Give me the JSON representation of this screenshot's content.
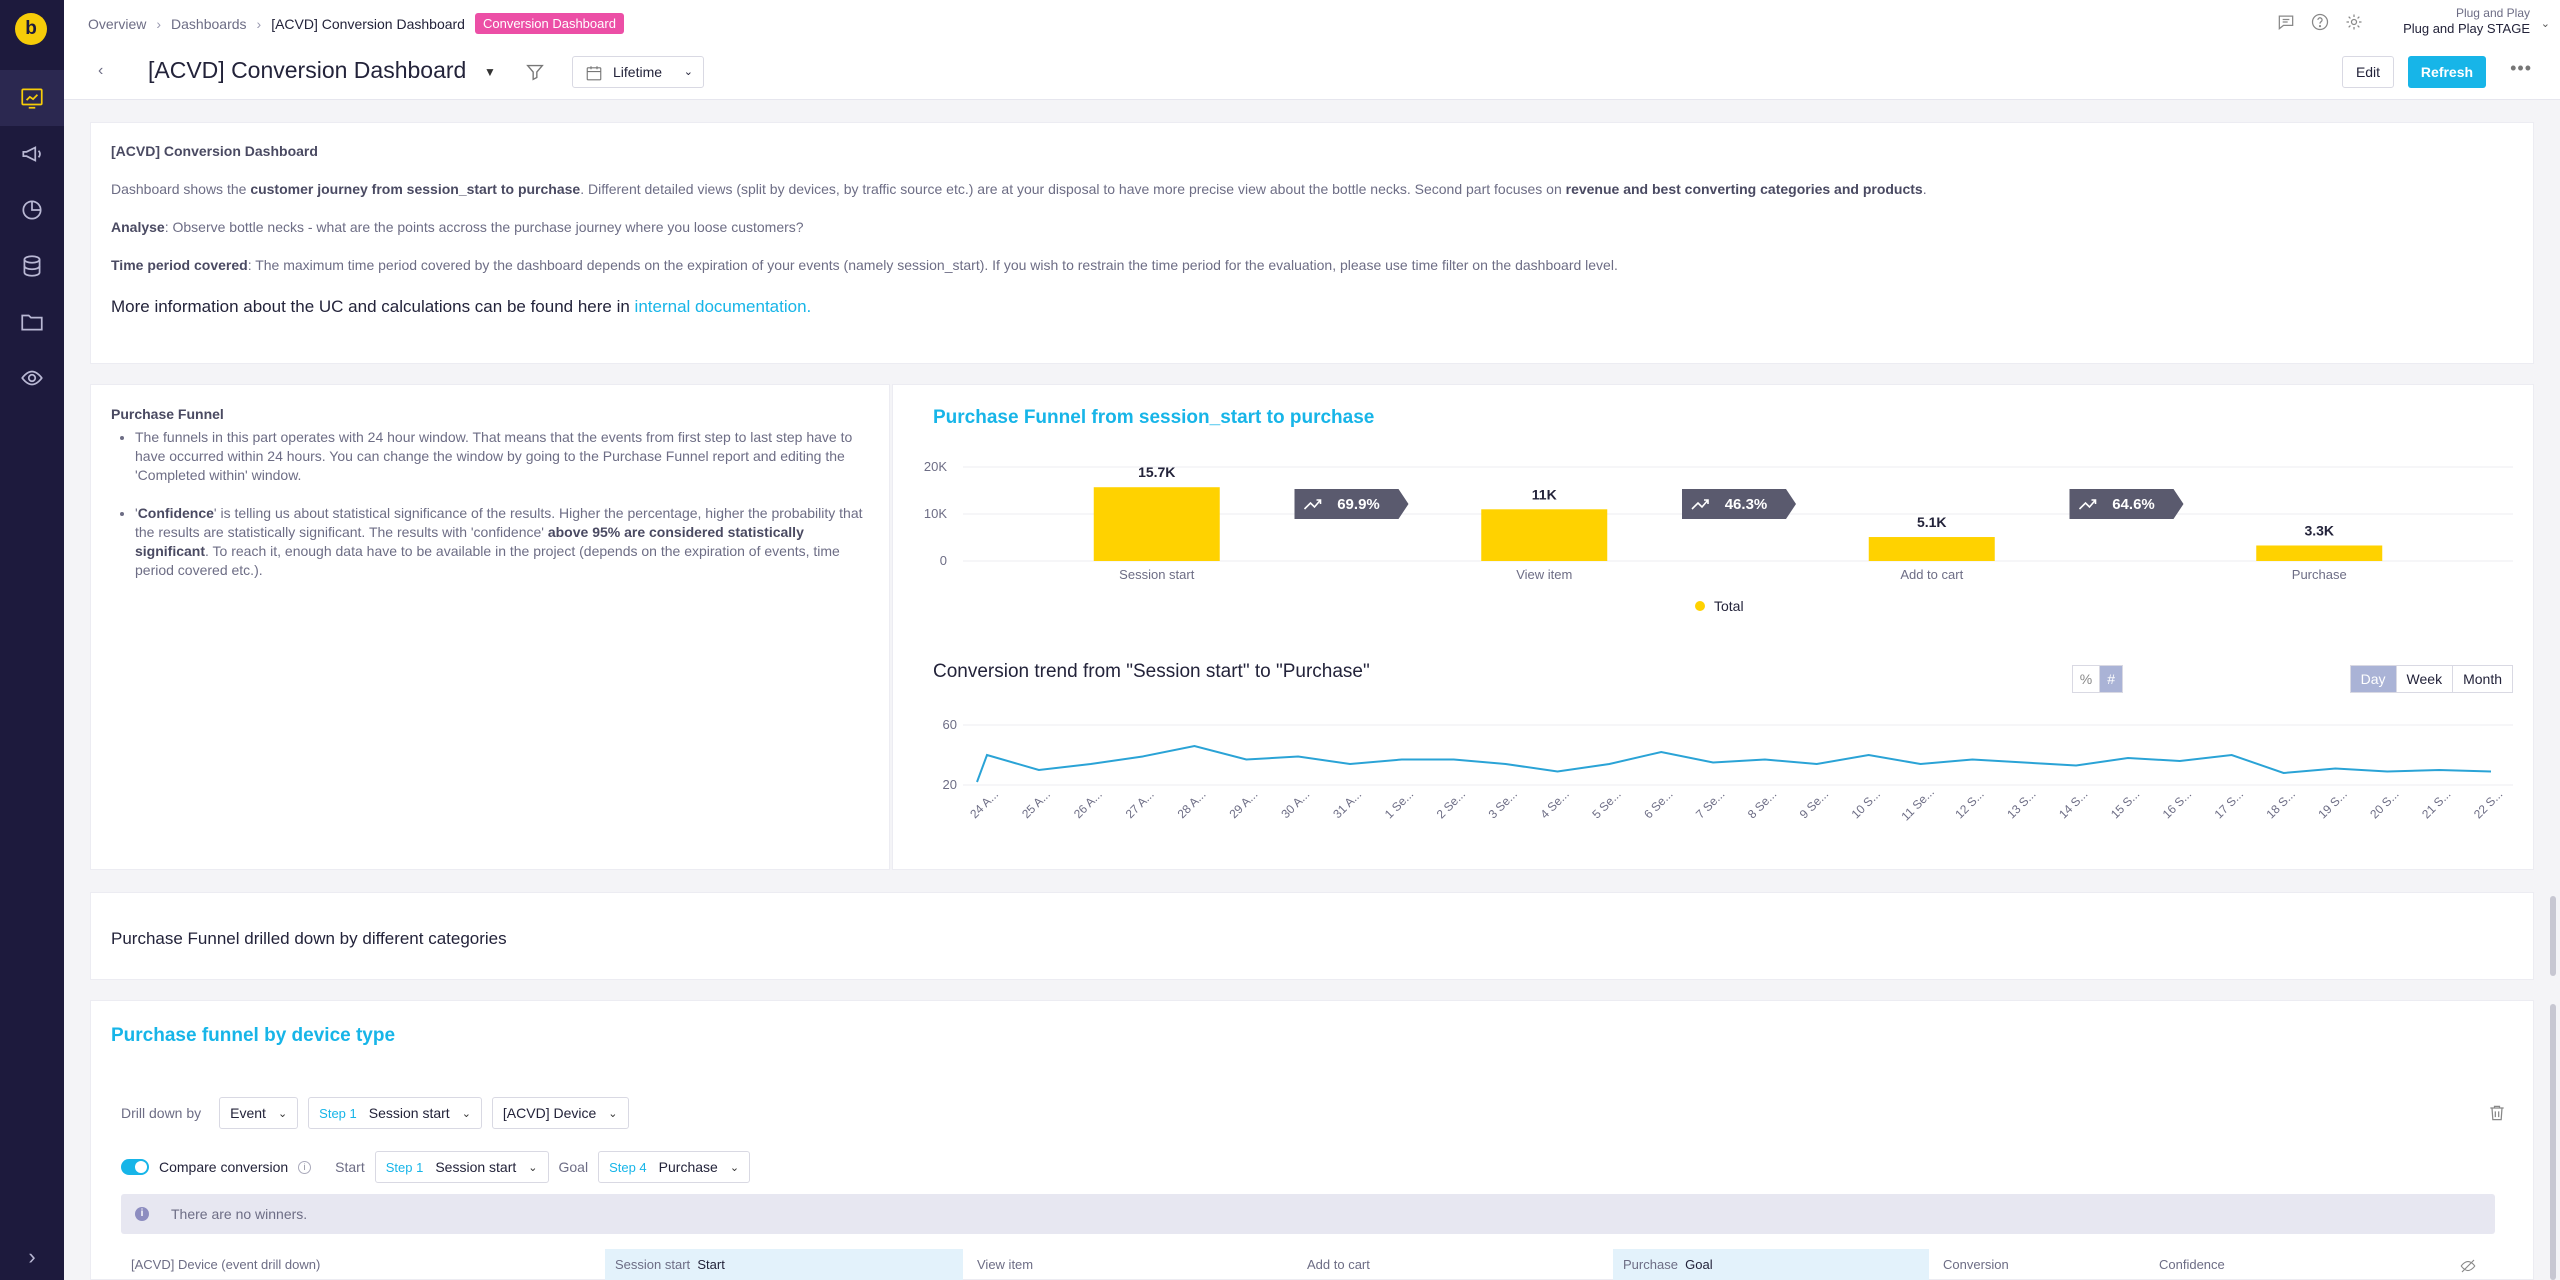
{
  "app": {
    "logo_letter": "b"
  },
  "sidebar": {
    "items": [
      "dashboard-icon",
      "megaphone-icon",
      "pie-chart-icon",
      "database-icon",
      "folder-icon",
      "eye-icon"
    ],
    "collapse": "›"
  },
  "breadcrumb": {
    "overview": "Overview",
    "dashboards": "Dashboards",
    "current": "[ACVD] Conversion Dashboard",
    "badge": "Conversion Dashboard"
  },
  "project": {
    "org": "Plug and Play",
    "name": "Plug and Play STAGE"
  },
  "header": {
    "title": "[ACVD] Conversion Dashboard",
    "date_range": "Lifetime",
    "edit": "Edit",
    "refresh": "Refresh",
    "more": "•••"
  },
  "intro": {
    "heading": "[ACVD] Conversion Dashboard",
    "p1_a": "Dashboard shows the ",
    "p1_b": "customer journey from session_start to purchase",
    "p1_c": ". Different detailed views (split by devices, by traffic source etc.) are at your disposal to have more precise view about the bottle necks. Second part focuses on ",
    "p1_d": "revenue and best converting categories and products",
    "p1_e": ".",
    "p2_a": "Analyse",
    "p2_b": ": Observe bottle necks - what are the points accross the purchase journey where you loose customers?",
    "p3_a": "Time period covered",
    "p3_b": ": The maximum time period covered by the dashboard depends on the expiration of your events (namely session_start). If you wish to restrain the time period for the evaluation, please use time filter on the dashboard level.",
    "more_a": "More information about the UC and calculations can be found here in ",
    "more_link": "internal documentation."
  },
  "funnel_text": {
    "title": "Purchase Funnel",
    "b1": "The funnels in this part operates with 24 hour window. That means that the events from first step to last step have to have occurred within 24 hours. You can change the window by going to the Purchase Funnel report and editing the 'Completed within' window.",
    "b2_a": "'",
    "b2_b": "Confidence",
    "b2_c": "' is telling us about statistical significance of the results. Higher the percentage, higher the probability that the results are statistically significant. The results with 'confidence' ",
    "b2_d": "above 95% are considered statistically significant",
    "b2_e": ". To reach it, enough data have to be available in the project (depends on the expiration of events, time period covered etc.)."
  },
  "chart_data": [
    {
      "type": "bar",
      "title": "Purchase Funnel from session_start to purchase",
      "categories": [
        "Session start",
        "View item",
        "Add to cart",
        "Purchase"
      ],
      "values": [
        15700,
        11000,
        5100,
        3300
      ],
      "value_labels": [
        "15.7K",
        "11K",
        "5.1K",
        "3.3K"
      ],
      "conversion_labels": [
        "69.9%",
        "46.3%",
        "64.6%"
      ],
      "y_ticks": [
        "20K",
        "10K",
        "0"
      ],
      "ylim": [
        0,
        20000
      ],
      "series": [
        {
          "name": "Total",
          "color": "#ffd200"
        }
      ],
      "legend": "bottom-center"
    },
    {
      "type": "line",
      "title": "Conversion trend from \"Session start\" to \"Purchase\"",
      "y_ticks": [
        "60",
        "20"
      ],
      "ylim": [
        20,
        60
      ],
      "x": [
        "24 A...",
        "25 A...",
        "26 A...",
        "27 A...",
        "28 A...",
        "29 A...",
        "30 A...",
        "31 A...",
        "1 Se...",
        "2 Se...",
        "3 Se...",
        "4 Se...",
        "5 Se...",
        "6 Se...",
        "7 Se...",
        "8 Se...",
        "9 Se...",
        "10 S...",
        "11 Se...",
        "12 S...",
        "13 S...",
        "14 S...",
        "15 S...",
        "16 S...",
        "17 S...",
        "18 S...",
        "19 S...",
        "20 S...",
        "21 S...",
        "22 S..."
      ],
      "values": [
        40,
        30,
        34,
        39,
        46,
        37,
        39,
        34,
        37,
        37,
        34,
        29,
        34,
        42,
        35,
        37,
        34,
        40,
        34,
        37,
        35,
        33,
        38,
        36,
        40,
        28,
        31,
        29,
        30,
        29
      ],
      "first_value": 22,
      "color": "#2aa3d6",
      "controls": {
        "percent": "%",
        "count": "#",
        "day": "Day",
        "week": "Week",
        "month": "Month"
      }
    }
  ],
  "section2": {
    "title": "Purchase Funnel drilled down by different categories"
  },
  "section3": {
    "title": "Purchase funnel by device type",
    "drill_label": "Drill down by",
    "drill_type": "Event",
    "step1_tag": "Step 1",
    "step1_name": "Session start",
    "attribute": "[ACVD] Device",
    "compare_label": "Compare conversion",
    "start_label": "Start",
    "goal_label": "Goal",
    "goal_tag": "Step 4",
    "goal_name": "Purchase",
    "no_winners": "There are no winners.",
    "columns": {
      "c0": "[ACVD] Device (event drill down)",
      "c1a": "Session start",
      "c1b": "Start",
      "c2": "View item",
      "c3": "Add to cart",
      "c4a": "Purchase",
      "c4b": "Goal",
      "c5": "Conversion",
      "c6": "Confidence"
    }
  }
}
